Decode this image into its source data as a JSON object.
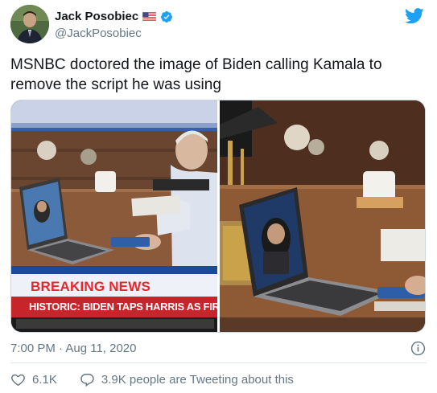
{
  "author": {
    "display_name": "Jack Posobiec",
    "handle": "@JackPosobiec",
    "flag_icon": "us-flag-icon",
    "verified_icon": "verified-badge-icon"
  },
  "brand": {
    "icon": "twitter-bird-icon",
    "color": "#1da1f2"
  },
  "tweet": {
    "text": "MSNBC doctored the image of Biden calling Kamala to remove the script he was using"
  },
  "media": {
    "left": {
      "banner": "BREAKING NEWS",
      "ticker": "HISTORIC: BIDEN TAPS HARRIS AS FIRST BL"
    }
  },
  "meta": {
    "timestamp": "7:00 PM · Aug 11, 2020",
    "info_icon": "info-icon"
  },
  "actions": {
    "likes": "6.1K",
    "conversation": "3.9K people are Tweeting about this"
  },
  "colors": {
    "text": "#14171a",
    "secondary": "#657786",
    "accent": "#1da1f2",
    "breaking_red": "#e8262b",
    "ticker_red": "#c8252b"
  }
}
